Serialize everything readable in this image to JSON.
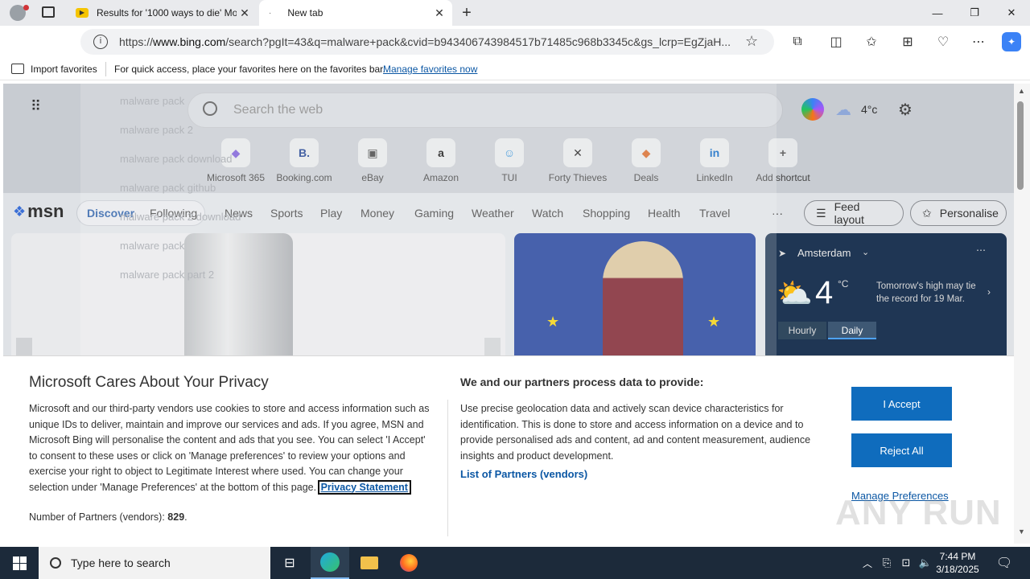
{
  "browser": {
    "tabs": [
      {
        "title": "Results for '1000 ways to die' Mo",
        "active": false
      },
      {
        "title": "New tab",
        "active": true
      }
    ],
    "url_prefix": "https://",
    "url_host": "www.bing.com",
    "url_rest": "/search?pgIt=43&q=malware+pack&cvid=b943406743984517b71485c968b3345c&gs_lcrp=EgZjaH...",
    "favorites": {
      "import_label": "Import favorites",
      "hint": "For quick access, place your favorites here on the favorites bar.",
      "manage_link": "Manage favorites now"
    }
  },
  "msn": {
    "search_placeholder": "Search the web",
    "temperature": "4°c",
    "shortcuts": [
      {
        "label": "Microsoft 365",
        "glyph": "◆",
        "color": "#7b5cd6"
      },
      {
        "label": "Booking.com",
        "glyph": "B.",
        "color": "#1b3f8f"
      },
      {
        "label": "eBay",
        "glyph": "▣",
        "color": "#444"
      },
      {
        "label": "Amazon",
        "glyph": "a",
        "color": "#111"
      },
      {
        "label": "TUI",
        "glyph": "☺",
        "color": "#2a8cd6"
      },
      {
        "label": "Forty Thieves",
        "glyph": "✕",
        "color": "#222"
      },
      {
        "label": "Deals",
        "glyph": "◆",
        "color": "#d66a2a"
      },
      {
        "label": "LinkedIn",
        "glyph": "in",
        "color": "#0a66c2"
      },
      {
        "label": "Add shortcut",
        "glyph": "+",
        "color": "#666"
      }
    ],
    "logo": "msn",
    "nav": [
      "Discover",
      "Following",
      "News",
      "Sports",
      "Play",
      "Money",
      "Gaming",
      "Weather",
      "Watch",
      "Shopping",
      "Health",
      "Travel"
    ],
    "more": "···",
    "feed_layout": "Feed layout",
    "personalise": "Personalise",
    "weather": {
      "city": "Amsterdam",
      "temp": "4",
      "unit": "°C",
      "note": "Tomorrow's high may tie the record for 19 Mar.",
      "tab_hourly": "Hourly",
      "tab_daily": "Daily"
    }
  },
  "ghost_suggestions": [
    "malware pack",
    "malware pack 2",
    "malware pack download",
    "malware pack github",
    "malware pack 2 download",
    "malware pack",
    "malware pack part 2"
  ],
  "privacy": {
    "title": "Microsoft Cares About Your Privacy",
    "body": "Microsoft and our third-party vendors use cookies to store and access information such as unique IDs to deliver, maintain and improve our services and ads. If you agree, MSN and Microsoft Bing will personalise the content and ads that you see. You can select 'I Accept' to consent to these uses or click on 'Manage preferences' to review your options and exercise your right to object to Legitimate Interest where used.  You can change your selection under 'Manage Preferences' at the bottom of this page.",
    "privacy_link": "Privacy Statement",
    "partners_label": "Number of Partners (vendors):",
    "partners_count": "829",
    "right_title": "We and our partners process data to provide:",
    "right_body": "Use precise geolocation data and actively scan device characteristics for identification. This is done to store and access information on a device and to provide personalised ads and content, ad and content measurement, audience insights and product development.",
    "vendors_link": "List of Partners (vendors)",
    "accept": "I Accept",
    "reject": "Reject All",
    "manage": "Manage Preferences"
  },
  "watermark": "ANY RUN",
  "taskbar": {
    "search_placeholder": "Type here to search",
    "time": "7:44 PM",
    "date": "3/18/2025"
  },
  "colors": {
    "accent": "#0f6cbd",
    "link": "#0b57a4",
    "taskbar": "#1c2a3a"
  }
}
